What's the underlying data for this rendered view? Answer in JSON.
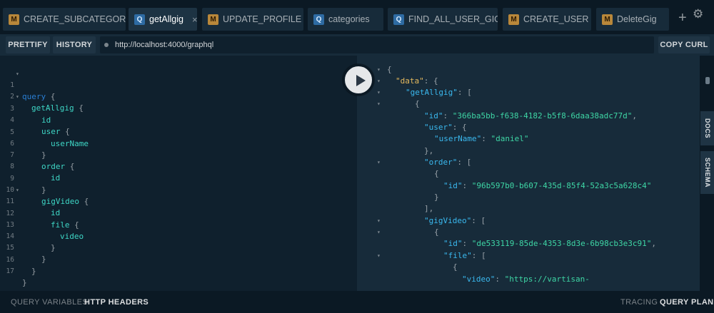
{
  "tabs": [
    {
      "badge": "M",
      "label": "CREATE_SUBCATEGORY"
    },
    {
      "badge": "Q",
      "label": "getAllgig",
      "close": "×"
    },
    {
      "badge": "M",
      "label": "UPDATE_PROFILE"
    },
    {
      "badge": "Q",
      "label": "categories"
    },
    {
      "badge": "Q",
      "label": "FIND_ALL_USER_GIG"
    },
    {
      "badge": "M",
      "label": "CREATE_USER"
    },
    {
      "badge": "M",
      "label": "DeleteGig"
    }
  ],
  "tabbar_icons": {
    "plus": "+",
    "gear": "⚙"
  },
  "toolbar": {
    "prettify": "PRETTIFY",
    "history": "HISTORY",
    "url": "http://localhost:4000/graphql",
    "copy_curl": "COPY CURL"
  },
  "editor": {
    "line_numbers": [
      "1",
      "2",
      "3",
      "4",
      "5",
      "6",
      "7",
      "8",
      "9",
      "10",
      "11",
      "12",
      "13",
      "14",
      "15",
      "16",
      "17"
    ],
    "lines": [
      {
        "a": "query",
        "b": " {"
      },
      {
        "a": "getAllgig",
        "b": " {"
      },
      {
        "a": "id",
        "b": ""
      },
      {
        "a": "user",
        "b": " {"
      },
      {
        "a": "userName",
        "b": ""
      },
      {
        "a": "",
        "b": "}"
      },
      {
        "a": "order",
        "b": " {"
      },
      {
        "a": "id",
        "b": ""
      },
      {
        "a": "",
        "b": "}"
      },
      {
        "a": "gigVideo",
        "b": " {"
      },
      {
        "a": "id",
        "b": ""
      },
      {
        "a": "file",
        "b": " {"
      },
      {
        "a": "video",
        "b": ""
      },
      {
        "a": "",
        "b": "}"
      },
      {
        "a": "",
        "b": "}"
      },
      {
        "a": "",
        "b": "}"
      },
      {
        "a": "",
        "b": "}"
      }
    ]
  },
  "result": {
    "lines": [
      {
        "k": "",
        "v": "{"
      },
      {
        "k": "\"data\"",
        "v": ": {"
      },
      {
        "k": "\"getAllgig\"",
        "v": ": ["
      },
      {
        "k": "",
        "v": "{"
      },
      {
        "k": "\"id\"",
        "v": ": ",
        "s": "\"366ba5bb-f638-4182-b5f8-6daa38adc77d\"",
        "e": ","
      },
      {
        "k": "\"user\"",
        "v": ": {"
      },
      {
        "k": "\"userName\"",
        "v": ": ",
        "s": "\"daniel\""
      },
      {
        "k": "",
        "v": "},"
      },
      {
        "k": "\"order\"",
        "v": ": ["
      },
      {
        "k": "",
        "v": "{"
      },
      {
        "k": "\"id\"",
        "v": ": ",
        "s": "\"96b597b0-b607-435d-85f4-52a3c5a628c4\""
      },
      {
        "k": "",
        "v": "}"
      },
      {
        "k": "",
        "v": "],"
      },
      {
        "k": "\"gigVideo\"",
        "v": ": ["
      },
      {
        "k": "",
        "v": "{"
      },
      {
        "k": "\"id\"",
        "v": ": ",
        "s": "\"de533119-85de-4353-8d3e-6b98cb3e3c91\"",
        "e": ","
      },
      {
        "k": "\"file\"",
        "v": ": ["
      },
      {
        "k": "",
        "v": "{"
      },
      {
        "k": "\"video\"",
        "v": ": ",
        "s": "\"https://vartisan-"
      }
    ]
  },
  "side_tabs": {
    "docs": "DOCS",
    "schema": "SCHEMA"
  },
  "bottom": {
    "query_variables": "QUERY VARIABLES",
    "http_headers": "HTTP HEADERS",
    "tracing": "TRACING",
    "query_plan": "QUERY PLAN"
  },
  "colors": {
    "bg": "#0f202d",
    "panel": "#172b3a",
    "mutation_badge": "#b8873a",
    "query_badge": "#2e6ba3",
    "keyword": "#2a7ed3",
    "field": "#3ed6c5",
    "json_key": "#3ab8ee",
    "json_data_key": "#e5b95d",
    "json_string": "#3ed6a5"
  },
  "icons": {
    "run": "play-icon",
    "settings": "gear-icon",
    "add_tab": "plus-icon"
  }
}
